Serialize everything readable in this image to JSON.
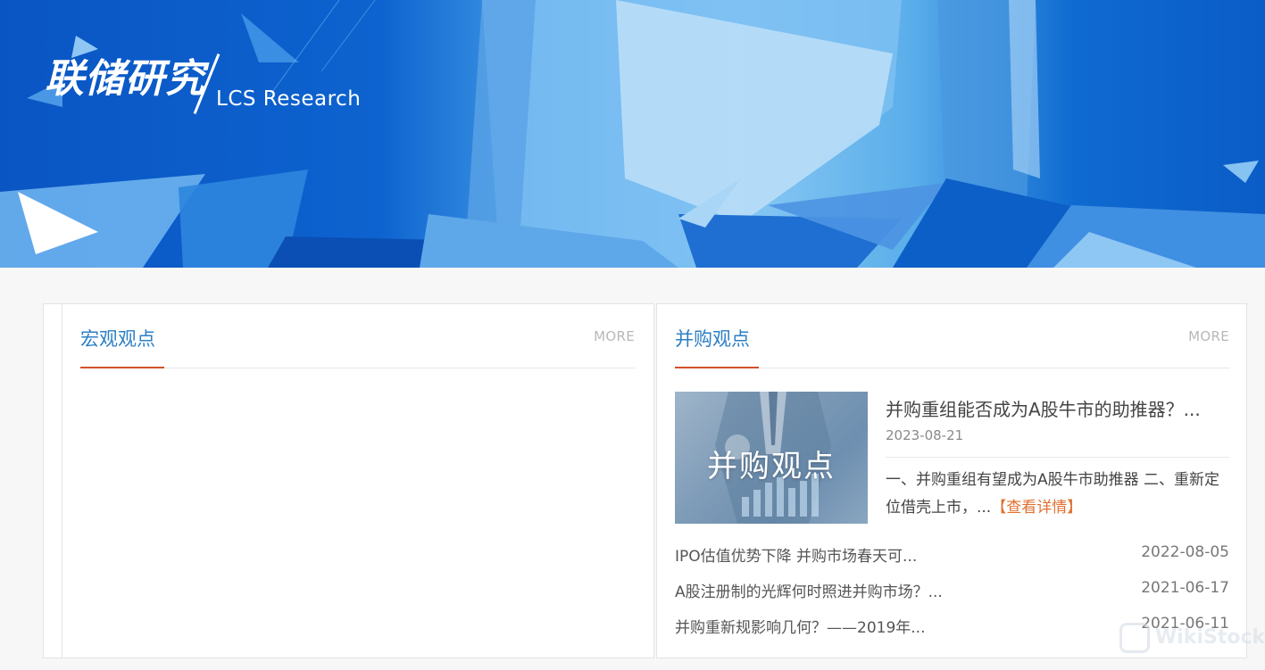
{
  "banner": {
    "brand_cn": "联储研究",
    "brand_en": "LCS Research"
  },
  "left_panel": {
    "title": "宏观观点",
    "more": "MORE"
  },
  "right_panel": {
    "title": "并购观点",
    "more": "MORE",
    "feature": {
      "thumb_label": "并购观点",
      "title": "并购重组能否成为A股牛市的助推器？...",
      "date": "2023-08-21",
      "summary": "一、并购重组有望成为A股牛市助推器 二、重新定位借壳上市，...",
      "detail_link": "【查看详情】"
    },
    "list": [
      {
        "title": "IPO估值优势下降 并购市场春天可...",
        "date": "2022-08-05"
      },
      {
        "title": "A股注册制的光辉何时照进并购市场？...",
        "date": "2021-06-17"
      },
      {
        "title": "并购重新规影响几何？——2019年...",
        "date": "2021-06-11"
      }
    ]
  },
  "watermark": {
    "text": "WikiStock"
  },
  "colors": {
    "accent_blue": "#2d7fc6",
    "underline_red": "#d2502a",
    "link_orange": "#e0702f"
  }
}
